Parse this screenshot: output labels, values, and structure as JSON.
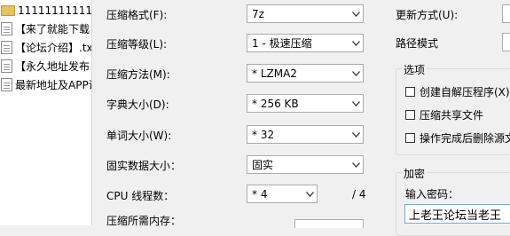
{
  "files": [
    {
      "name": "111111111111",
      "type": "folder"
    },
    {
      "name": "【来了就能下载",
      "type": "doc"
    },
    {
      "name": "【论坛介绍】.tx",
      "type": "doc"
    },
    {
      "name": "【永久地址发布",
      "type": "doc"
    },
    {
      "name": "最新地址及APP说",
      "type": "doc"
    }
  ],
  "settings": {
    "format": {
      "label": "压缩格式(F):",
      "value": "7z"
    },
    "level": {
      "label": "压缩等级(L):",
      "value": "1 - 极速压缩"
    },
    "method": {
      "label": "压缩方法(M):",
      "value": "* LZMA2"
    },
    "dict": {
      "label": "字典大小(D):",
      "value": "* 256 KB"
    },
    "word": {
      "label": "单词大小(W):",
      "value": "* 32"
    },
    "solid": {
      "label": "固实数据大小：",
      "value": "固实"
    },
    "cpu": {
      "label": "CPU 线程数：",
      "value": "* 4",
      "max": "/ 4"
    },
    "memory": {
      "label": "压缩所需内存："
    }
  },
  "right": {
    "update_label": "更新方式(U):",
    "path_label": "路径模式",
    "options_title": "选项",
    "options": [
      {
        "label": "创建自解压程序(X)",
        "checked": false
      },
      {
        "label": "压缩共享文件",
        "checked": false
      },
      {
        "label": "操作完成后删除源文",
        "checked": false
      }
    ],
    "encrypt_title": "加密",
    "password_label": "输入密码：",
    "password_value": "上老王论坛当老王"
  }
}
